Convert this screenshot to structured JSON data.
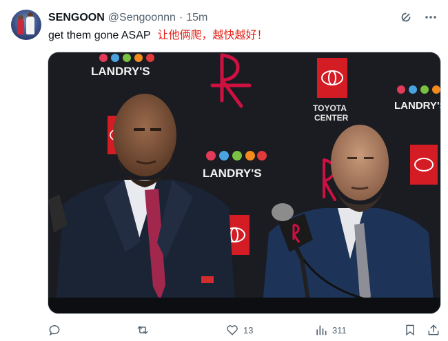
{
  "author": {
    "name": "SENGOON",
    "handle": "@Sengoonnn",
    "separator": "·",
    "time": "15m"
  },
  "tweet": {
    "text": "get them gone ASAP",
    "translation": "让他俩爬，越快越好！"
  },
  "media": {
    "sponsor_left": "LANDRY'S",
    "sponsor_center": "LANDRY'S",
    "sponsor_right": "LANDRY'S",
    "venue_line1": "TOYOTA",
    "venue_line2": "CENTER"
  },
  "actions": {
    "replies": "",
    "reposts": "",
    "likes": "13",
    "views": "311"
  },
  "icons": {
    "grok": "grok-icon",
    "more": "more-icon",
    "reply": "reply-icon",
    "repost": "repost-icon",
    "like": "heart-icon",
    "views": "views-icon",
    "bookmark": "bookmark-icon",
    "share": "share-icon"
  },
  "colors": {
    "translation": "#e2231a",
    "secondary_text": "#536471",
    "rockets_red": "#ce1141"
  }
}
